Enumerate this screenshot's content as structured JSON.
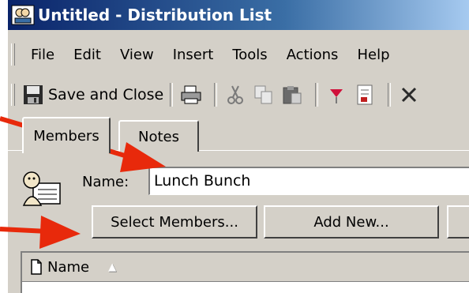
{
  "window": {
    "title": "Untitled - Distribution List"
  },
  "menubar": {
    "items": [
      "File",
      "Edit",
      "View",
      "Insert",
      "Tools",
      "Actions",
      "Help"
    ]
  },
  "toolbar": {
    "save_close_label": "Save and Close"
  },
  "tabs": [
    {
      "label": "Members",
      "active": true
    },
    {
      "label": "Notes",
      "active": false
    }
  ],
  "form": {
    "name_label": "Name:",
    "name_value": "Lunch Bunch",
    "select_members_label": "Select Members...",
    "add_new_label": "Add New..."
  },
  "members_list": {
    "column_header": "Name",
    "sort_indicator": "▲"
  },
  "colors": {
    "annotation_arrow": "#e8290b",
    "title_gradient_start": "#0a246a",
    "window_face": "#d4d0c8"
  },
  "icons": [
    "distribution-list-app-icon",
    "floppy-save-icon",
    "printer-icon",
    "scissors-cut-icon",
    "copy-icon",
    "paste-icon",
    "flag-icon",
    "address-icon",
    "delete-x-icon",
    "distribution-list-icon",
    "document-column-icon"
  ]
}
